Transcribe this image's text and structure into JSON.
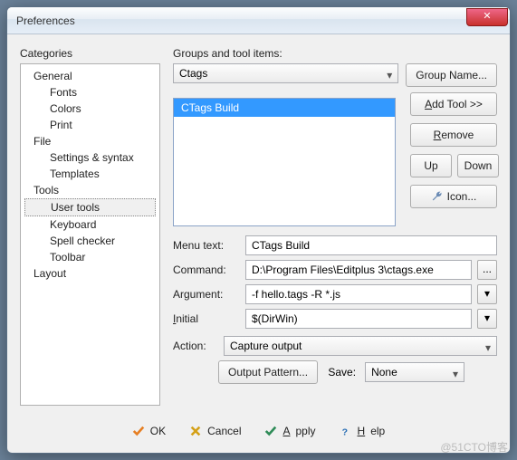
{
  "window": {
    "title": "Preferences"
  },
  "left": {
    "heading": "Categories",
    "tree": {
      "general": "General",
      "fonts": "Fonts",
      "colors": "Colors",
      "print": "Print",
      "file": "File",
      "settings": "Settings & syntax",
      "templates": "Templates",
      "tools": "Tools",
      "user_tools": "User tools",
      "keyboard": "Keyboard",
      "spell": "Spell checker",
      "toolbar": "Toolbar",
      "layout": "Layout"
    }
  },
  "right": {
    "heading": "Groups and tool items:",
    "group_selected": "Ctags",
    "btn_group_name": "Group Name...",
    "list_item": "CTags Build",
    "btn_add_tool": "Add Tool >>",
    "btn_remove": "Remove",
    "btn_up": "Up",
    "btn_down": "Down",
    "btn_icon": "Icon...",
    "form": {
      "menu_text_label": "Menu text:",
      "menu_text_value": "CTags Build",
      "command_label": "Command:",
      "command_value": "D:\\Program Files\\Editplus 3\\ctags.exe",
      "argument_label": "Argument:",
      "argument_value": "-f hello.tags -R *.js",
      "initial_label": "Initial",
      "initial_value": "$(DirWin)",
      "action_label": "Action:",
      "action_value": "Capture output",
      "output_pattern": "Output Pattern...",
      "save_label": "Save:",
      "save_value": "None"
    }
  },
  "footer": {
    "ok": "OK",
    "cancel": "Cancel",
    "apply": "Apply",
    "help": "Help"
  },
  "watermark": "@51CTO博客"
}
